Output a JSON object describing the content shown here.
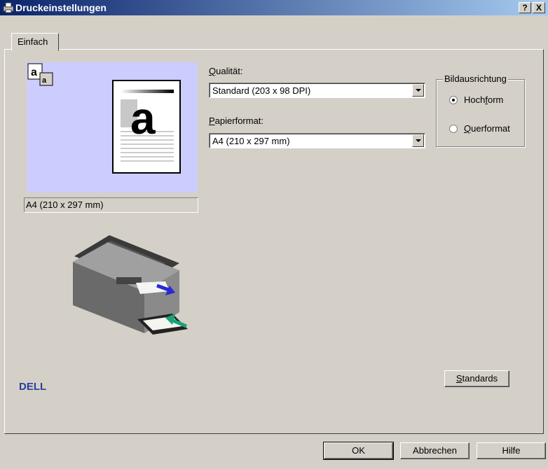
{
  "window": {
    "title": "Druckeinstellungen",
    "help_label": "?",
    "close_label": "X"
  },
  "tabs": [
    {
      "label": "Einfach"
    }
  ],
  "preview": {
    "paper_glyph": "a",
    "caption": "A4 (210 x 297 mm)"
  },
  "quality": {
    "label_accel": "Q",
    "label_rest": "ualität:",
    "value": "Standard (203 x 98 DPI)"
  },
  "paper_format": {
    "label_accel": "P",
    "label_rest": "apierformat:",
    "value": "A4 (210 x 297 mm)"
  },
  "orientation": {
    "title": "Bildausrichtung",
    "portrait_pre": "Hoch",
    "portrait_accel": "f",
    "portrait_post": "orm",
    "landscape_accel": "Q",
    "landscape_rest": "uerformat",
    "selected": "portrait"
  },
  "buttons": {
    "standards_accel": "S",
    "standards_rest": "tandards",
    "ok": "OK",
    "cancel": "Abbrechen",
    "help": "Hilfe"
  },
  "brand": {
    "logo_text": "DELL",
    "color": "#2a3f99"
  },
  "colors": {
    "dialog_bg": "#d4d0c8",
    "preview_bg": "#ccccff",
    "arrow_blue": "#2a2ad4",
    "arrow_green": "#1aa37a"
  }
}
